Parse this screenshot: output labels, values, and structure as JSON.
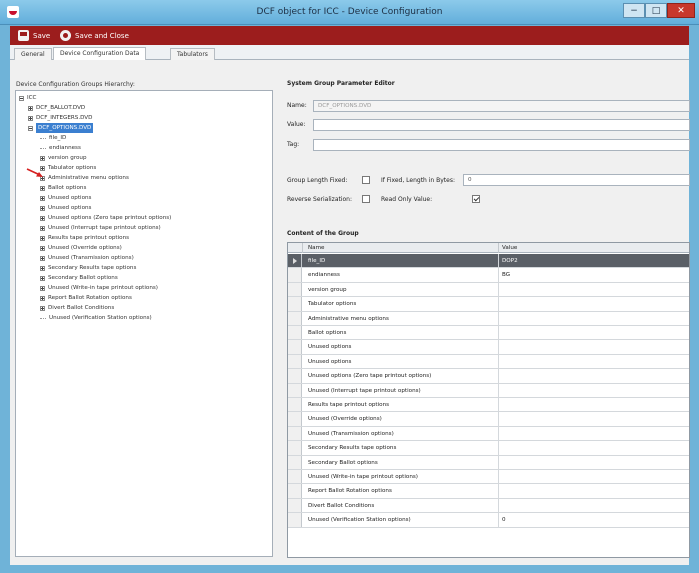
{
  "window": {
    "title": "DCF object for ICC - Device Configuration"
  },
  "toolbar": {
    "save_label": "Save",
    "save_close_label": "Save and Close"
  },
  "tabs": [
    {
      "label": "General"
    },
    {
      "label": "Device Configuration Data"
    },
    {
      "label": "Tabulators"
    }
  ],
  "tree": {
    "caption": "Device Configuration Groups Hierarchy:",
    "items": [
      {
        "label": "ICC"
      },
      {
        "label": "DCF_BALLOT.DVD"
      },
      {
        "label": "DCF_INTEGERS.DVD"
      },
      {
        "label": "DCF_OPTIONS.DVD"
      },
      {
        "label": "file_ID"
      },
      {
        "label": "endianness"
      },
      {
        "label": "version group"
      },
      {
        "label": "Tabulator options"
      },
      {
        "label": "Administrative menu options"
      },
      {
        "label": "Ballot options"
      },
      {
        "label": "Unused options"
      },
      {
        "label": "Unused options"
      },
      {
        "label": "Unused options (Zero tape printout options)"
      },
      {
        "label": "Unused (Interrupt tape printout options)"
      },
      {
        "label": "Results tape printout options"
      },
      {
        "label": "Unused (Override options)"
      },
      {
        "label": "Unused (Transmission options)"
      },
      {
        "label": "Secondary Results tape options"
      },
      {
        "label": "Secondary Ballot options"
      },
      {
        "label": "Unused (Write-in tape printout options)"
      },
      {
        "label": "Report Ballot Rotation options"
      },
      {
        "label": "Divert Ballot Conditions"
      },
      {
        "label": "Unused (Verification Station options)"
      }
    ]
  },
  "editor": {
    "title": "System Group Parameter Editor",
    "name_label": "Name:",
    "name_value": "DCF_OPTIONS.DVD",
    "value_label": "Value:",
    "tag_label": "Tag:",
    "group_length_fixed_label": "Group Length Fixed:",
    "if_fixed_label": "If Fixed, Length in Bytes:",
    "length_value": "0",
    "reverse_serialization_label": "Reverse Serialization:",
    "read_only_label": "Read Only Value:"
  },
  "grid": {
    "title": "Content of the Group",
    "col_name": "Name",
    "col_value": "Value",
    "rows": [
      {
        "name": "file_ID",
        "value": "DOP2"
      },
      {
        "name": "endianness",
        "value": "BG"
      },
      {
        "name": "version group",
        "value": ""
      },
      {
        "name": "Tabulator options",
        "value": ""
      },
      {
        "name": "Administrative menu options",
        "value": ""
      },
      {
        "name": "Ballot options",
        "value": ""
      },
      {
        "name": "Unused options",
        "value": ""
      },
      {
        "name": "Unused options",
        "value": ""
      },
      {
        "name": "Unused options (Zero tape printout options)",
        "value": ""
      },
      {
        "name": "Unused (Interrupt tape printout options)",
        "value": ""
      },
      {
        "name": "Results tape printout options",
        "value": ""
      },
      {
        "name": "Unused (Override options)",
        "value": ""
      },
      {
        "name": "Unused (Transmission options)",
        "value": ""
      },
      {
        "name": "Secondary Results tape options",
        "value": ""
      },
      {
        "name": "Secondary Ballot options",
        "value": ""
      },
      {
        "name": "Unused (Write-in tape printout options)",
        "value": ""
      },
      {
        "name": "Report Ballot Rotation options",
        "value": ""
      },
      {
        "name": "Divert Ballot Conditions",
        "value": ""
      },
      {
        "name": "Unused (Verification Station options)",
        "value": "0"
      }
    ]
  },
  "colors": {
    "toolbar": "#9c1d1d",
    "selection": "#3b7fd0",
    "titlebar": "#62aedb",
    "arrow": "#d62020"
  }
}
